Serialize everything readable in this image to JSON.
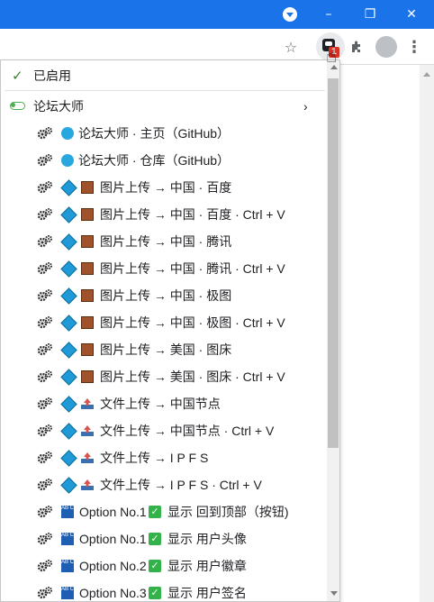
{
  "menu": {
    "enabled_label": "已启用",
    "extension_name": "论坛大师",
    "items": [
      {
        "icon": "globe-icon",
        "label": "论坛大师 · 主页（GitHub）"
      },
      {
        "icon": "globe-icon",
        "label": "论坛大师 · 仓库（GitHub）"
      },
      {
        "icon": "image-icon",
        "label": "图片上传 → 中国 · 百度"
      },
      {
        "icon": "image-icon",
        "label": "图片上传 → 中国 · 百度 · Ctrl + V"
      },
      {
        "icon": "image-icon",
        "label": "图片上传 → 中国 · 腾讯"
      },
      {
        "icon": "image-icon",
        "label": "图片上传 → 中国 · 腾讯 · Ctrl + V"
      },
      {
        "icon": "image-icon",
        "label": "图片上传 → 中国 · 极图"
      },
      {
        "icon": "image-icon",
        "label": "图片上传 → 中国 · 极图 · Ctrl + V"
      },
      {
        "icon": "image-icon",
        "label": "图片上传 → 美国 · 图床"
      },
      {
        "icon": "image-icon",
        "label": "图片上传 → 美国 · 图床 · Ctrl + V"
      },
      {
        "icon": "upload-icon",
        "label": "文件上传 → 中国节点"
      },
      {
        "icon": "upload-icon",
        "label": "文件上传 → 中国节点 · Ctrl + V"
      },
      {
        "icon": "upload-icon",
        "label": "文件上传 → I P F S"
      },
      {
        "icon": "upload-icon",
        "label": "文件上传 → I P F S · Ctrl + V"
      },
      {
        "icon": "option",
        "label": "Option No.1",
        "text": "显示 回到顶部（按钮)"
      },
      {
        "icon": "option",
        "label": "Option No.1",
        "text": "显示 用户头像"
      },
      {
        "icon": "option",
        "label": "Option No.2",
        "text": "显示 用户徽章"
      },
      {
        "icon": "option",
        "label": "Option No.3",
        "text": "显示 用户签名"
      }
    ]
  },
  "badge_count": "1"
}
